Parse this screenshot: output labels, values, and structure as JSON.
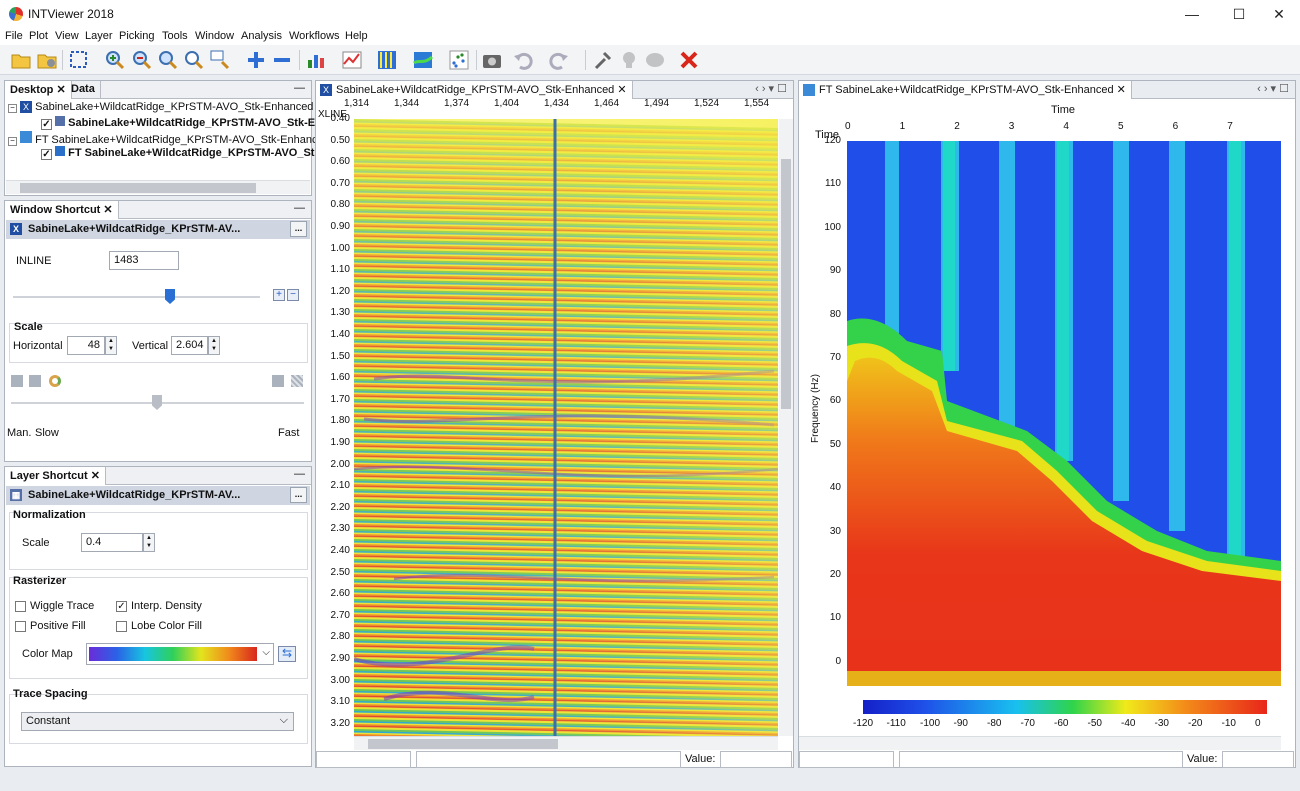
{
  "app": {
    "title": "INTViewer 2018"
  },
  "window_controls": {
    "minimize": "—",
    "maximize": "☐",
    "close": "✕"
  },
  "menu": [
    "File",
    "Plot",
    "View",
    "Layer",
    "Picking",
    "Tools",
    "Window",
    "Analysis",
    "Workflows",
    "Help"
  ],
  "toolbar": {
    "icons": [
      "open-folder-icon",
      "open-settings-icon",
      "zoom-box-icon",
      "zoom-in-icon",
      "zoom-out-icon",
      "zoom-fit-icon",
      "zoom-reset-icon",
      "zoom-select-icon",
      "add-icon",
      "remove-icon",
      "bar-chart-icon",
      "line-chart-icon",
      "seismic-trace-icon",
      "map-icon",
      "scatter-icon",
      "camera-icon",
      "undo-icon",
      "redo-icon",
      "pick-tool-icon",
      "lightbulb-icon",
      "brain-icon",
      "delete-icon"
    ]
  },
  "desktop_panel": {
    "tabs": [
      "Desktop",
      "Data"
    ],
    "tree": [
      {
        "label": "SabineLake+WildcatRidge_KPrSTM-AVO_Stk-Enhanced",
        "bold": false
      },
      {
        "label": "SabineLake+WildcatRidge_KPrSTM-AVO_Stk-En",
        "bold": true
      },
      {
        "label": "FT SabineLake+WildcatRidge_KPrSTM-AVO_Stk-Enhanc",
        "bold": false
      },
      {
        "label": "FT SabineLake+WildcatRidge_KPrSTM-AVO_Stk",
        "bold": true
      }
    ]
  },
  "window_shortcut": {
    "tab": "Window Shortcut",
    "header": "SabineLake+WildcatRidge_KPrSTM-AV...",
    "dots": "...",
    "inline_label": "INLINE",
    "inline_value": "1483",
    "scale_title": "Scale",
    "horizontal_label": "Horizontal",
    "horizontal_value": "48",
    "vertical_label": "Vertical",
    "vertical_value": "2.604",
    "speed_left": "Man.",
    "speed_slow": "Slow",
    "speed_fast": "Fast"
  },
  "layer_shortcut": {
    "tab": "Layer Shortcut",
    "header": "SabineLake+WildcatRidge_KPrSTM-AV...",
    "dots": "...",
    "normalization_title": "Normalization",
    "scale_label": "Scale",
    "scale_value": "0.4",
    "rasterizer_title": "Rasterizer",
    "wiggle": "Wiggle Trace",
    "interp": "Interp. Density",
    "positive": "Positive Fill",
    "lobe": "Lobe Color Fill",
    "colormap_label": "Color Map",
    "trace_spacing_title": "Trace Spacing",
    "trace_spacing_value": "Constant",
    "checks": {
      "wiggle": false,
      "interp": true,
      "positive": false,
      "lobe": false
    }
  },
  "seismic_view": {
    "tab": "SabineLake+WildcatRidge_KPrSTM-AVO_Stk-Enhanced",
    "axis_label": "XLINE",
    "xticks": [
      "1,314",
      "1,344",
      "1,374",
      "1,404",
      "1,434",
      "1,464",
      "1,494",
      "1,524",
      "1,554"
    ],
    "yticks": [
      "0.40",
      "0.50",
      "0.60",
      "0.70",
      "0.80",
      "0.90",
      "1.00",
      "1.10",
      "1.20",
      "1.30",
      "1.40",
      "1.50",
      "1.60",
      "1.70",
      "1.80",
      "1.90",
      "2.00",
      "2.10",
      "2.20",
      "2.30",
      "2.40",
      "2.50",
      "2.60",
      "2.70",
      "2.80",
      "2.90",
      "3.00",
      "3.10",
      "3.20"
    ],
    "value_label": "Value:"
  },
  "ft_view": {
    "tab": "FT SabineLake+WildcatRidge_KPrSTM-AVO_Stk-Enhanced",
    "xlabel": "Time",
    "corner": "Time",
    "ylabel": "Frequency (Hz)",
    "xticks": [
      "0",
      "1",
      "2",
      "3",
      "4",
      "5",
      "6",
      "7"
    ],
    "yticks": [
      "120",
      "110",
      "100",
      "90",
      "80",
      "70",
      "60",
      "50",
      "40",
      "30",
      "20",
      "10",
      "0"
    ],
    "colorbar_ticks": [
      "-120",
      "-110",
      "-100",
      "-90",
      "-80",
      "-70",
      "-60",
      "-50",
      "-40",
      "-30",
      "-20",
      "-10",
      "0"
    ],
    "value_label": "Value:"
  }
}
